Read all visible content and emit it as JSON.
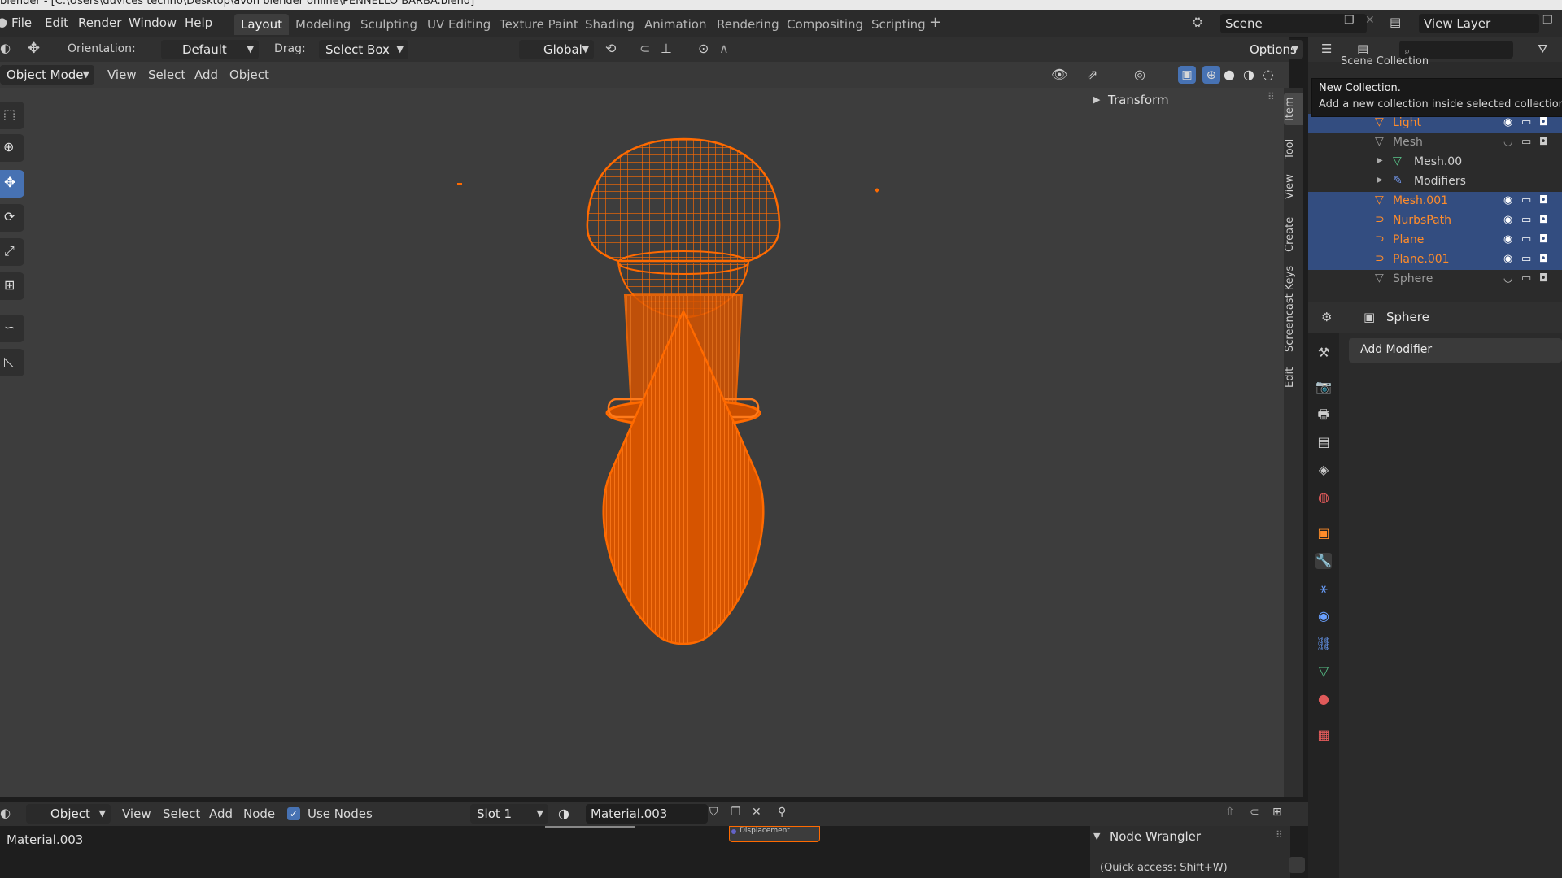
{
  "window": {
    "title": "blender - [C:\\Users\\duvices techno\\Desktop\\avon blender online\\PENNELLO BARBA.blend]"
  },
  "menu": [
    "File",
    "Edit",
    "Render",
    "Window",
    "Help"
  ],
  "workspaces": [
    "Layout",
    "Modeling",
    "Sculpting",
    "UV Editing",
    "Texture Paint",
    "Shading",
    "Animation",
    "Rendering",
    "Compositing",
    "Scripting"
  ],
  "workspace_add": "+",
  "scene": {
    "label": "Scene",
    "view_layer": "View Layer"
  },
  "tool_header": {
    "orientation_label": "Orientation:",
    "orientation_value": "Default",
    "drag_label": "Drag:",
    "drag_value": "Select Box",
    "transform_orientation": "Global",
    "options": "Options"
  },
  "viewport_header": {
    "mode": "Object Mode",
    "menus": [
      "View",
      "Select",
      "Add",
      "Object"
    ]
  },
  "npanel": {
    "transform": "Transform",
    "tabs": [
      "Item",
      "Tool",
      "View",
      "Create",
      "Screencast Keys",
      "Edit"
    ]
  },
  "outliner": {
    "scene_collection": "Scene Collection",
    "rows": [
      {
        "name": "Light",
        "color": "#ff8c2a",
        "selected": true
      },
      {
        "name": "Mesh",
        "color": "#9a9a9a",
        "selected": false
      },
      {
        "name": "Mesh.00",
        "color": "#d0d0d0",
        "selected": false
      },
      {
        "name": "Modifiers",
        "color": "#d0d0d0",
        "selected": false
      },
      {
        "name": "Mesh.001",
        "color": "#ff8c2a",
        "selected": true
      },
      {
        "name": "NurbsPath",
        "color": "#ff8c2a",
        "selected": true
      },
      {
        "name": "Plane",
        "color": "#ff8c2a",
        "selected": true
      },
      {
        "name": "Plane.001",
        "color": "#ff8c2a",
        "selected": true
      },
      {
        "name": "Sphere",
        "color": "#9a9a9a",
        "selected": false
      }
    ]
  },
  "tooltip": {
    "title": "New Collection.",
    "description": "Add a new collection inside selected collection."
  },
  "properties": {
    "object_name": "Sphere",
    "add_modifier": "Add Modifier"
  },
  "node_header": {
    "editor_type": "Object",
    "menus": [
      "View",
      "Select",
      "Add",
      "Node"
    ],
    "use_nodes": "Use Nodes",
    "slot": "Slot 1",
    "material": "Material.003"
  },
  "node_editor": {
    "material_label": "Material.003",
    "node_socket": "Displacement",
    "node_wrangler": "Node Wrangler",
    "quick_access": "(Quick access: Shift+W)"
  },
  "colors": {
    "accent_blue": "#4772b3",
    "selection_orange": "#ff6a00",
    "viewport_bg": "#3d3d3d"
  }
}
